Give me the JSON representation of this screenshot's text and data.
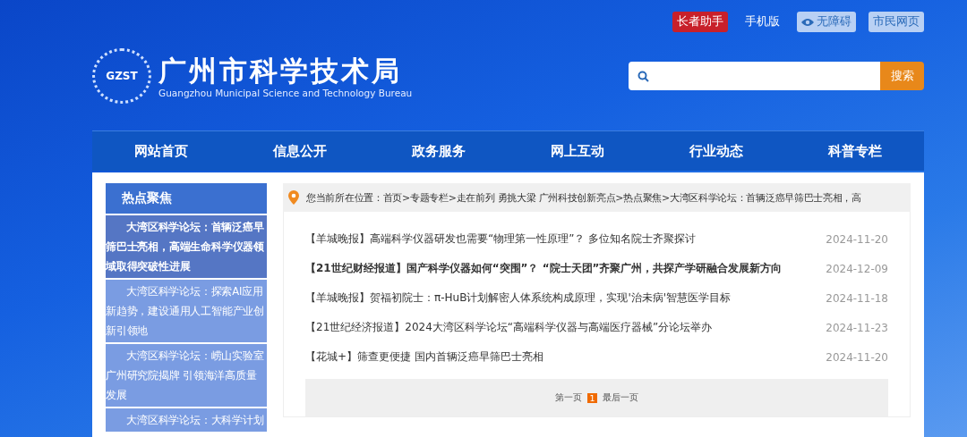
{
  "top_links": [
    {
      "label": "长者助手",
      "kind": "red"
    },
    {
      "label": "手机版",
      "kind": "plain"
    },
    {
      "label": "无障碍",
      "kind": "eye"
    },
    {
      "label": "市民网页",
      "kind": "light"
    }
  ],
  "logo": {
    "badge": "GZST",
    "title": "广州市科学技术局",
    "subtitle": "Guangzhou Municipal Science and Technology Bureau"
  },
  "search": {
    "button": "搜索"
  },
  "nav": [
    "网站首页",
    "信息公开",
    "政务服务",
    "网上互动",
    "行业动态",
    "科普专栏"
  ],
  "sidebar": {
    "title": "热点聚焦",
    "items": [
      {
        "label": "大湾区科学论坛：首辆泛癌早筛巴士亮相，高端生命科学仪器领域取得突破性进展",
        "selected": true
      },
      {
        "label": "大湾区科学论坛：探索AI应用新趋势，建设通用人工智能产业创新引领地",
        "selected": false
      },
      {
        "label": "大湾区科学论坛：崂山实验室广州研究院揭牌 引领海洋高质量发展",
        "selected": false
      },
      {
        "label": "大湾区科学论坛：大科学计划",
        "selected": false
      }
    ]
  },
  "breadcrumb": "您当前所在位置：首页>专题专栏>走在前列 勇挑大梁 广州科技创新亮点>热点聚焦>大湾区科学论坛：首辆泛癌早筛巴士亮相，高",
  "news": [
    {
      "title": "【羊城晚报】高端科学仪器研发也需要“物理第一性原理”？ 多位知名院士齐聚探讨",
      "date": "2024-11-20",
      "emphasized": false
    },
    {
      "title": "【21世纪财经报道】国产科学仪器如何“突围”？ “院士天团”齐聚广州，共探产学研融合发展新方向",
      "date": "2024-12-09",
      "emphasized": true
    },
    {
      "title": "【羊城晚报】贺福初院士：π-HuB计划解密人体系统构成原理，实现'治未病'智慧医学目标",
      "date": "2024-11-18",
      "emphasized": false
    },
    {
      "title": "【21世纪经济报道】2024大湾区科学论坛“高端科学仪器与高端医疗器械”分论坛举办",
      "date": "2024-11-23",
      "emphasized": false
    },
    {
      "title": "【花城+】筛查更便捷 国内首辆泛癌早筛巴士亮相",
      "date": "2024-11-20",
      "emphasized": false
    }
  ],
  "pagination": {
    "first": "第一页",
    "pages": [
      {
        "label": "1",
        "selected": true
      }
    ],
    "last": "最后一页"
  }
}
